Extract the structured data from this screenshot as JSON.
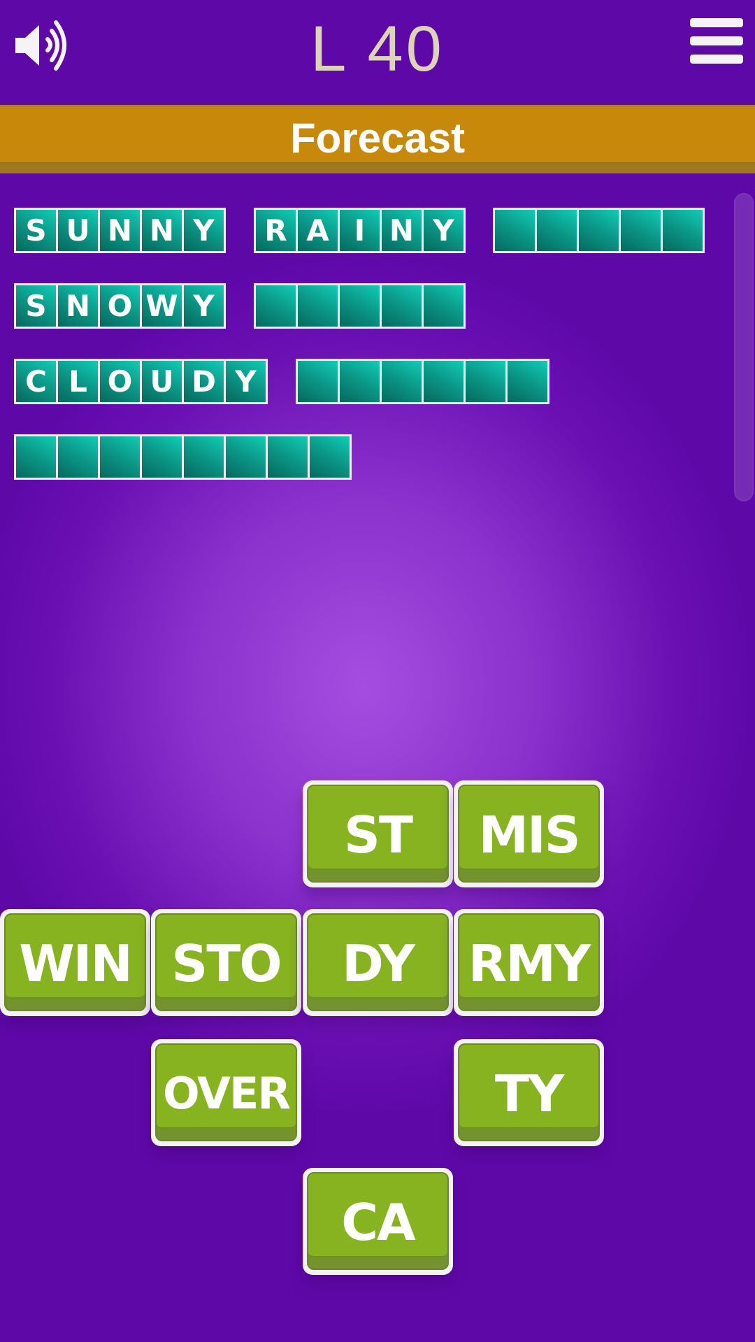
{
  "header": {
    "level_label": "L 40",
    "sound_icon": "speaker-on-icon",
    "menu_icon": "hamburger-menu-icon"
  },
  "category": {
    "title": "Forecast"
  },
  "colors": {
    "background_edge": "#5e08a8",
    "background_center": "#a64de0",
    "banner": "#c8880a",
    "tile_cell": "#0b9686",
    "button_green": "#86b31f",
    "level_text": "#dcd3b8"
  },
  "words": [
    {
      "row": 1,
      "length": 5,
      "letters": [
        "S",
        "U",
        "N",
        "N",
        "Y"
      ],
      "solved": true
    },
    {
      "row": 1,
      "length": 5,
      "letters": [
        "R",
        "A",
        "I",
        "N",
        "Y"
      ],
      "solved": true
    },
    {
      "row": 1,
      "length": 5,
      "letters": [
        "",
        "",
        "",
        "",
        ""
      ],
      "solved": false
    },
    {
      "row": 2,
      "length": 5,
      "letters": [
        "S",
        "N",
        "O",
        "W",
        "Y"
      ],
      "solved": true
    },
    {
      "row": 2,
      "length": 5,
      "letters": [
        "",
        "",
        "",
        "",
        ""
      ],
      "solved": false
    },
    {
      "row": 3,
      "length": 6,
      "letters": [
        "C",
        "L",
        "O",
        "U",
        "D",
        "Y"
      ],
      "solved": true
    },
    {
      "row": 3,
      "length": 6,
      "letters": [
        "",
        "",
        "",
        "",
        "",
        ""
      ],
      "solved": false
    },
    {
      "row": 4,
      "length": 8,
      "letters": [
        "",
        "",
        "",
        "",
        "",
        "",
        "",
        ""
      ],
      "solved": false
    }
  ],
  "tiles": [
    {
      "label": "ST"
    },
    {
      "label": "MIS"
    },
    {
      "label": "WIN"
    },
    {
      "label": "STO"
    },
    {
      "label": "DY"
    },
    {
      "label": "RMY"
    },
    {
      "label": "OVER"
    },
    {
      "label": "TY"
    },
    {
      "label": "CA"
    }
  ]
}
